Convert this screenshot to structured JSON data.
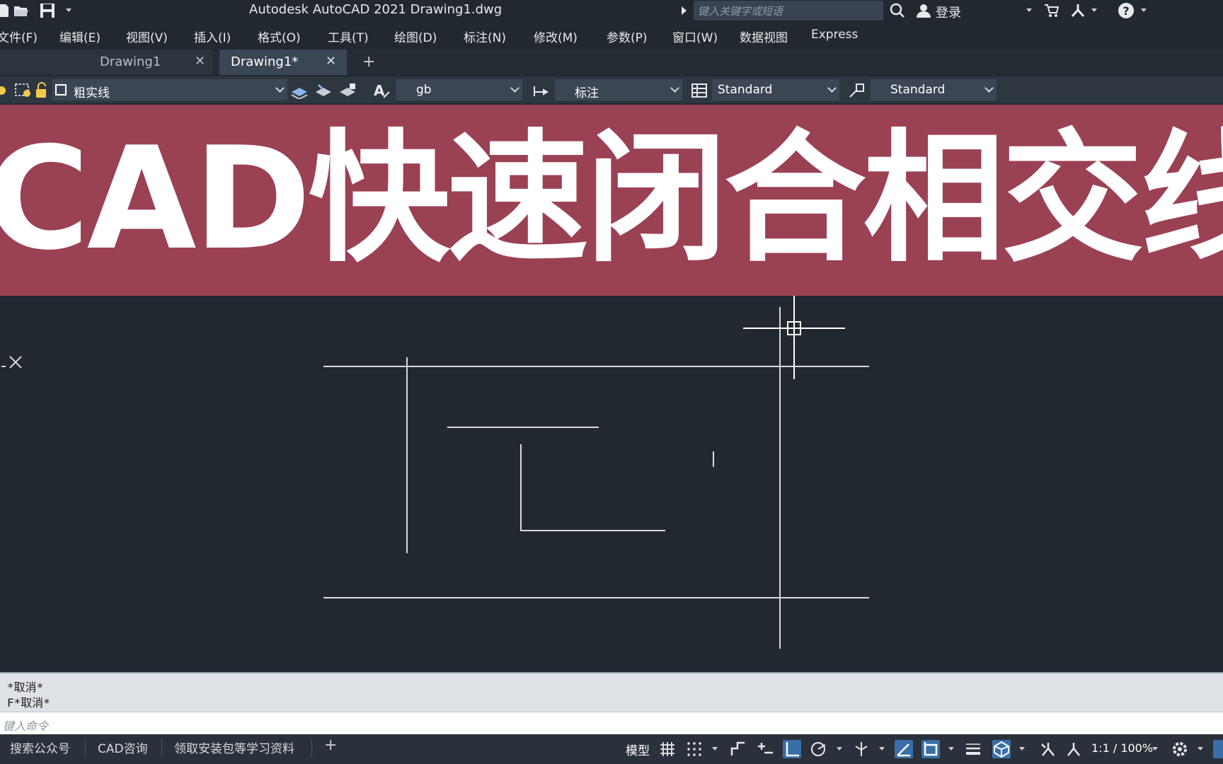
{
  "window": {
    "title": "Autodesk AutoCAD 2021    Drawing1.dwg",
    "search_placeholder": "键入关键字或短语",
    "login_label": "登录"
  },
  "menu": [
    "文件(F)",
    "编辑(E)",
    "视图(V)",
    "插入(I)",
    "格式(O)",
    "工具(T)",
    "绘图(D)",
    "标注(N)",
    "修改(M)",
    "参数(P)",
    "窗口(W)",
    "数据视图",
    "Express"
  ],
  "tabs": [
    {
      "label": "Drawing1",
      "close": "✕"
    },
    {
      "label": "Drawing1*",
      "close": "✕"
    }
  ],
  "tab_add": "+",
  "toolbar": {
    "layer_value": "粗实线",
    "text_style_value": "gb",
    "dim_style_value": "标注",
    "table_style_value": "Standard",
    "multileader_style_value": "Standard"
  },
  "banner": {
    "text": "CAD快速闭合相交线",
    "color": "#9b4154"
  },
  "command": {
    "history": [
      "*取消*",
      "F*取消*"
    ],
    "input_placeholder": "键入命令"
  },
  "status": {
    "layout_tabs": [
      "搜索公众号",
      "CAD咨询",
      "领取安装包等学习资料"
    ],
    "layout_add": "+",
    "model_label": "模型",
    "scale_label": "1:1 / 100%"
  },
  "colors": {
    "background": "#212830",
    "accent": "#3a6ea8",
    "drawing_lines": "#d7dbdf"
  },
  "icons": [
    "new-file-icon",
    "open-folder-icon",
    "save-icon",
    "search-icon",
    "user-icon",
    "cart-icon",
    "autodesk-a360-icon",
    "help-icon",
    "gear-icon",
    "grid-icon",
    "snap-icon",
    "ortho-icon",
    "polar-icon",
    "osnap-icon",
    "lineweight-icon",
    "workspace-icon",
    "annotation-icon"
  ]
}
